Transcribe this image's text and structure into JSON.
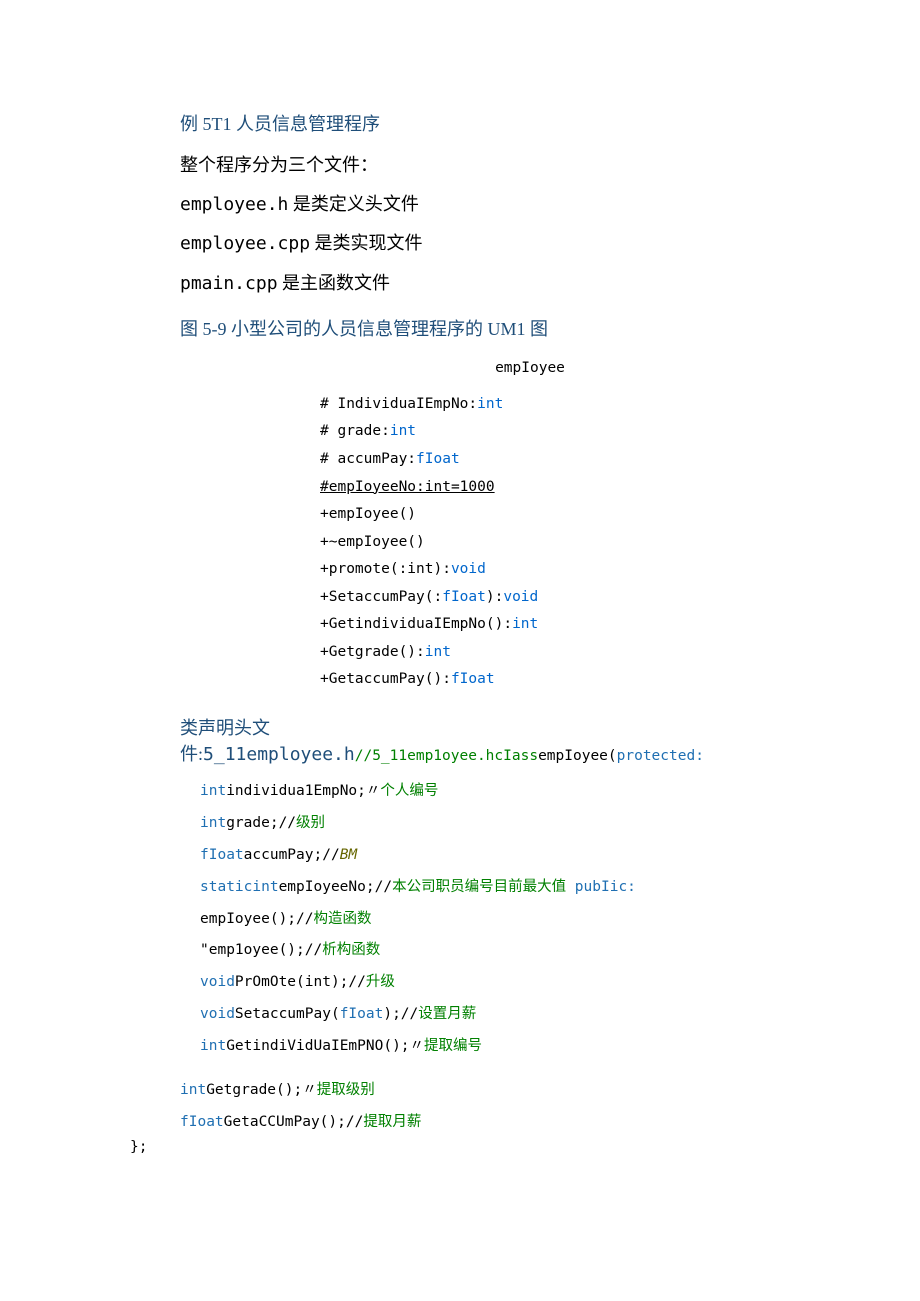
{
  "title1": "例 5T1 人员信息管理程序",
  "intro": {
    "line1": "整个程序分为三个文件：",
    "line2a": "employee.h",
    "line2b": " 是类定义头文件",
    "line3a": "employee.cpp",
    "line3b": " 是类实现文件",
    "line4a": "pmain.cpp",
    "line4b": " 是主函数文件"
  },
  "title2": "图 5-9 小型公司的人员信息管理程序的 UM1 图",
  "uml": {
    "classname": "empIoyee",
    "rows": [
      {
        "pre": "#  IndividuaIEmpNo:",
        "type": "int"
      },
      {
        "pre": "#  grade:",
        "type": "int"
      },
      {
        "pre": "#  accumPay:",
        "type": "fIoat"
      },
      {
        "pre": "#empIoyeeNo:int=1000",
        "type": "",
        "underline": true
      },
      {
        "pre": "+empIoyee()",
        "type": ""
      },
      {
        "pre": "+~empIoyee()",
        "type": ""
      },
      {
        "pre": "+promote(:int):",
        "type": "void"
      },
      {
        "pre": "+SetaccumPay(:",
        "mid": "fIoat",
        "post": "):",
        "type": "void"
      },
      {
        "pre": "+GetindividuaIEmpNo():",
        "type": "int"
      },
      {
        "pre": "+Getgrade():",
        "type": "int"
      },
      {
        "pre": "+GetaccumPay():",
        "type": "fIoat"
      }
    ]
  },
  "codeheader": {
    "prefix": "  类声明头文件:",
    "filename": "5_11employee.h",
    "inline1": "//5_11emp1oyee.hcIass",
    "inline2": "empIoyee(",
    "inline3": "protected:"
  },
  "code": [
    {
      "kw": "int",
      "txt": "individua1EmpNo;〃",
      "cm": "个人编号",
      "cmcolor": "green"
    },
    {
      "kw": "int",
      "txt": "grade;//",
      "cm": "级别",
      "cmcolor": "green"
    },
    {
      "kw": "fIoat",
      "txt": "accumPay;//",
      "cm": "BM",
      "cmcolor": "olive"
    },
    {
      "kw": "staticint",
      "txt": "empIoyeeNo;//",
      "cm": "本公司职员编号目前最大值",
      "cmcolor": "green",
      "tail": " pubIic:"
    },
    {
      "kw": "",
      "txt": "empIoyee();//",
      "cm": "构造函数",
      "cmcolor": "green"
    },
    {
      "kw": "",
      "txt": "\"emp1oyee();//",
      "cm": "析构函数",
      "cmcolor": "green"
    },
    {
      "kw": "void",
      "txt": "PrOmOte(int);//",
      "cm": "升级",
      "cmcolor": "green"
    },
    {
      "kw": "void",
      "txt": "SetaccumPay(",
      "mid": "fIoat",
      "txt2": ");//",
      "cm": "设置月薪",
      "cmcolor": "green"
    },
    {
      "kw": "int",
      "txt": "GetindiVidUaIEmPNO();〃",
      "cm": "提取编号",
      "cmcolor": "green"
    }
  ],
  "tail": [
    {
      "kw": "int",
      "txt": "Getgrade();〃",
      "cm": "提取级别",
      "cmcolor": "green"
    },
    {
      "kw": "fIoat",
      "txt": "GetaCCUmPay();//",
      "cm": "提取月薪",
      "cmcolor": "green"
    }
  ],
  "closing": "};"
}
